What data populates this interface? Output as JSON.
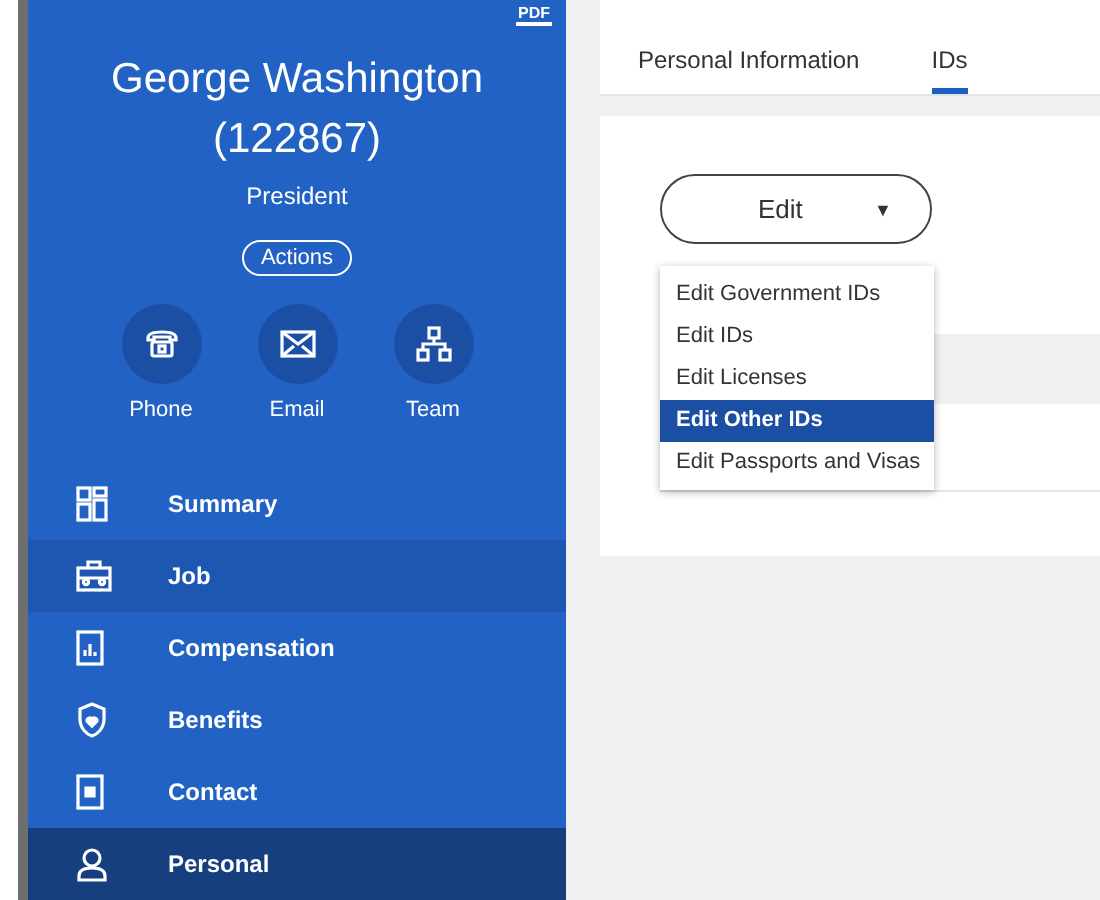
{
  "profile": {
    "pdf_label": "PDF",
    "name": "George Washington (122867)",
    "title": "President",
    "actions_label": "Actions",
    "contacts": [
      {
        "kind": "phone",
        "label": "Phone"
      },
      {
        "kind": "email",
        "label": "Email"
      },
      {
        "kind": "team",
        "label": "Team"
      }
    ]
  },
  "sidebar": {
    "items": [
      {
        "kind": "summary",
        "label": "Summary",
        "highlighted": false,
        "selected": false
      },
      {
        "kind": "job",
        "label": "Job",
        "highlighted": true,
        "selected": false
      },
      {
        "kind": "compensation",
        "label": "Compensation",
        "highlighted": false,
        "selected": false
      },
      {
        "kind": "benefits",
        "label": "Benefits",
        "highlighted": false,
        "selected": false
      },
      {
        "kind": "contact",
        "label": "Contact",
        "highlighted": false,
        "selected": false
      },
      {
        "kind": "personal",
        "label": "Personal",
        "highlighted": false,
        "selected": true
      }
    ]
  },
  "tabs": [
    {
      "label": "Personal Information",
      "selected": false
    },
    {
      "label": "IDs",
      "selected": true
    }
  ],
  "edit_button": {
    "label": "Edit",
    "caret": "▼",
    "expanded": true
  },
  "menu": {
    "items": [
      {
        "label": "Edit Government IDs",
        "selected": false
      },
      {
        "label": "Edit IDs",
        "selected": false
      },
      {
        "label": "Edit Licenses",
        "selected": false
      },
      {
        "label": "Edit Other IDs",
        "selected": true
      },
      {
        "label": "Edit Passports and Visas",
        "selected": false
      }
    ]
  }
}
